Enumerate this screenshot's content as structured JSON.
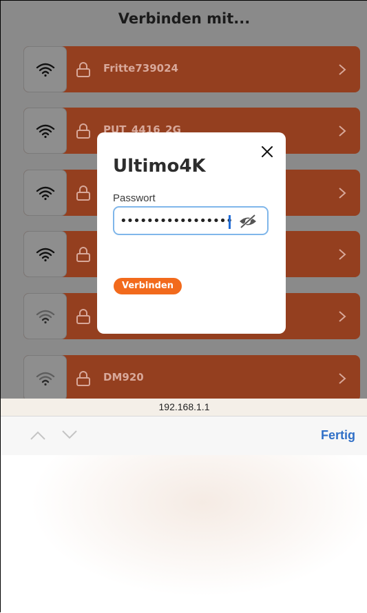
{
  "header": {
    "title": "Verbinden mit..."
  },
  "networks": [
    {
      "name": "Fritte739024",
      "signal": "strong"
    },
    {
      "name": "PUT_4416_2G",
      "signal": "strong"
    },
    {
      "name": "",
      "signal": "strong"
    },
    {
      "name": "",
      "signal": "strong"
    },
    {
      "name": "",
      "signal": "weak"
    },
    {
      "name": "DM920",
      "signal": "weak"
    }
  ],
  "modal": {
    "title": "Ultimo4K",
    "password_label": "Passwort",
    "password_value": "•••••••••••••••••",
    "connect_label": "Verbinden"
  },
  "browser": {
    "url": "192.168.1.1",
    "done_label": "Fertig"
  },
  "colors": {
    "accent": "#f26a1c",
    "row": "#943f1f",
    "link": "#2f6fc7"
  }
}
